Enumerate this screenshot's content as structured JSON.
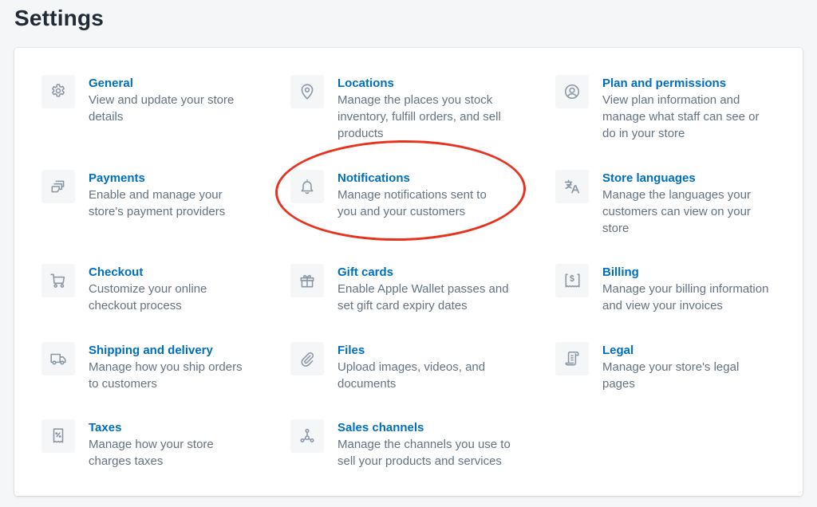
{
  "page": {
    "title": "Settings"
  },
  "colors": {
    "link": "#006fbb",
    "description": "#637381",
    "icon": "#8a96a3",
    "highlight": "#e8321e"
  },
  "settings": [
    {
      "key": "general",
      "icon": "gear-icon",
      "title": "General",
      "desc_lines": [
        "View and update your store",
        "details"
      ]
    },
    {
      "key": "payments",
      "icon": "payments-icon",
      "title": "Payments",
      "desc_lines": [
        "Enable and manage your",
        "store's payment providers"
      ]
    },
    {
      "key": "checkout",
      "icon": "cart-icon",
      "title": "Checkout",
      "desc_lines": [
        "Customize your online",
        "checkout process"
      ]
    },
    {
      "key": "shipping",
      "icon": "truck-icon",
      "title": "Shipping and delivery",
      "desc_lines": [
        "Manage how you ship orders",
        "to customers"
      ]
    },
    {
      "key": "taxes",
      "icon": "tax-receipt-icon",
      "title": "Taxes",
      "desc_lines": [
        "Manage how your store",
        "charges taxes"
      ]
    },
    {
      "key": "locations",
      "icon": "location-pin-icon",
      "title": "Locations",
      "desc_lines": [
        "Manage the places you stock",
        "inventory, fulfill orders, and sell",
        "products"
      ]
    },
    {
      "key": "notifications",
      "icon": "bell-icon",
      "title": "Notifications",
      "desc_lines": [
        "Manage notifications sent to",
        "you and your customers"
      ],
      "highlighted": true
    },
    {
      "key": "gift_cards",
      "icon": "gift-icon",
      "title": "Gift cards",
      "desc_lines": [
        "Enable Apple Wallet passes and",
        "set gift card expiry dates"
      ]
    },
    {
      "key": "files",
      "icon": "paperclip-icon",
      "title": "Files",
      "desc_lines": [
        "Upload images, videos, and",
        "documents"
      ]
    },
    {
      "key": "sales_channels",
      "icon": "sales-channels-icon",
      "title": "Sales channels",
      "desc_lines": [
        "Manage the channels you use to",
        "sell your products and services"
      ]
    },
    {
      "key": "plan",
      "icon": "user-circle-icon",
      "title": "Plan and permissions",
      "desc_lines": [
        "View plan information and",
        "manage what staff can see or",
        "do in your store"
      ]
    },
    {
      "key": "languages",
      "icon": "translate-icon",
      "title": "Store languages",
      "desc_lines": [
        "Manage the languages your",
        "customers can view on your",
        "store"
      ]
    },
    {
      "key": "billing",
      "icon": "billing-icon",
      "title": "Billing",
      "desc_lines": [
        "Manage your billing information",
        "and view your invoices"
      ]
    },
    {
      "key": "legal",
      "icon": "legal-scroll-icon",
      "title": "Legal",
      "desc_lines": [
        "Manage your store's legal",
        "pages"
      ]
    }
  ]
}
